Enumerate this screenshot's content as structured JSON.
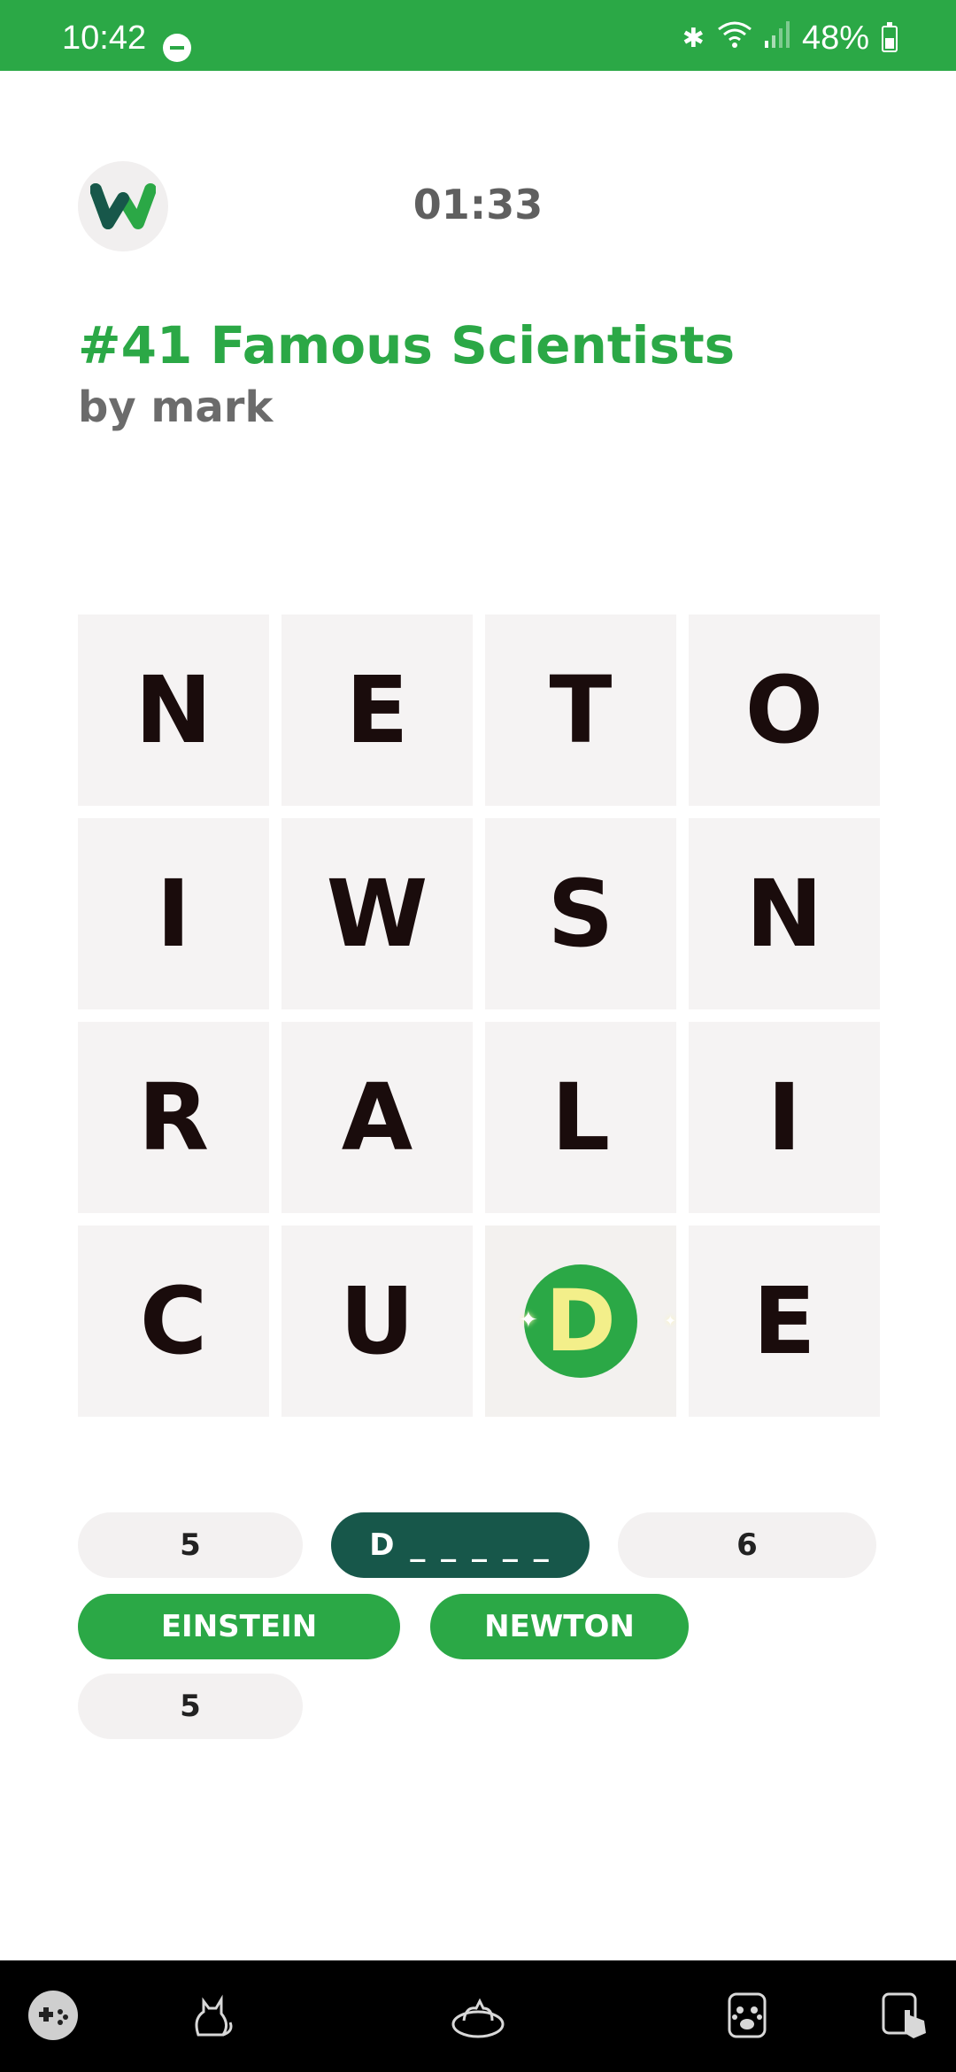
{
  "status_bar": {
    "time": "10:42",
    "battery": "48%",
    "icons": [
      "do-not-disturb-icon",
      "bluetooth-icon",
      "wifi-icon",
      "signal-icon",
      "battery-icon"
    ]
  },
  "header": {
    "timer": "01:33",
    "title": "#41 Famous Scientists",
    "author": "by mark"
  },
  "grid": {
    "rows": [
      [
        "N",
        "E",
        "T",
        "O"
      ],
      [
        "I",
        "W",
        "S",
        "N"
      ],
      [
        "R",
        "A",
        "L",
        "I"
      ],
      [
        "C",
        "U",
        "D",
        "E"
      ]
    ],
    "highlighted": {
      "row": 3,
      "col": 2,
      "letter": "D"
    }
  },
  "words": [
    {
      "label": "5",
      "state": "hidden"
    },
    {
      "label": "D _ _ _ _ _",
      "state": "active"
    },
    {
      "label": "6",
      "state": "hidden"
    },
    {
      "label": "EINSTEIN",
      "state": "found"
    },
    {
      "label": "NEWTON",
      "state": "found"
    },
    {
      "label": "5",
      "state": "hidden"
    }
  ],
  "colors": {
    "brand_green": "#2ba846",
    "active_chip": "#17574a",
    "tile_bg": "#f5f3f3",
    "highlight_letter": "#f3ef8a"
  },
  "bottom_nav": [
    "games-icon",
    "cat-sitting-icon",
    "cat-bed-icon",
    "paw-badge-icon",
    "app-touch-icon"
  ]
}
